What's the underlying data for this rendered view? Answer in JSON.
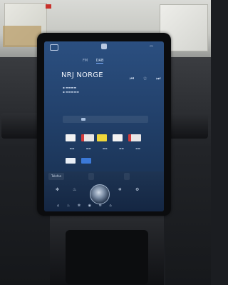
{
  "radio": {
    "station_name": "NRJ NORGE",
    "tabs": [
      "FM",
      "DAB"
    ],
    "active_tab_index": 1
  },
  "bottom_bar": {
    "left_label": "Telefon",
    "mid_label": "",
    "right_label": ""
  }
}
